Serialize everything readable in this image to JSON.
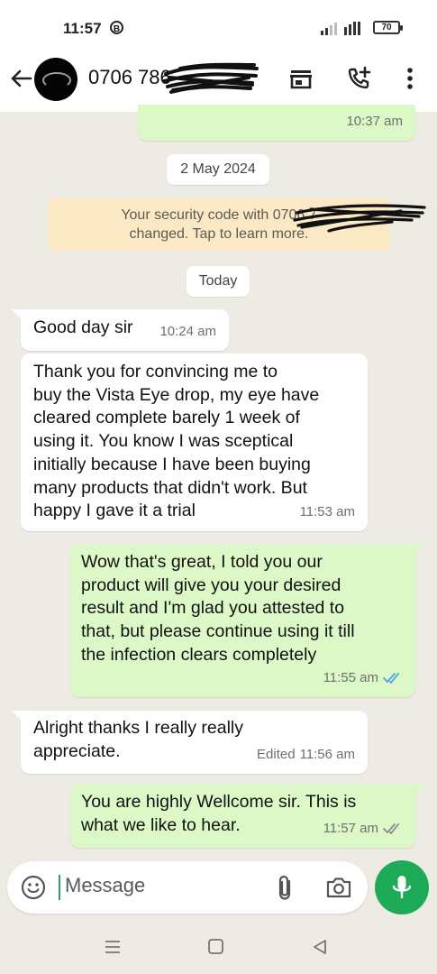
{
  "status_bar": {
    "time": "11:57",
    "notification_badge": "B",
    "battery": "70"
  },
  "header": {
    "contact_name": "0706 786"
  },
  "date_chips": [
    "2 May 2024",
    "Today"
  ],
  "security_notice": {
    "line1": "Your security code with 0706 7",
    "line2": "changed. Tap to learn more."
  },
  "messages": [
    {
      "direction": "out",
      "text": "",
      "time": "10:37 am"
    },
    {
      "direction": "in",
      "text": "Good day sir",
      "time": "10:24 am"
    },
    {
      "direction": "in",
      "lines": [
        "Thank you for convincing me to",
        "buy the Vista Eye drop, my eye have",
        "cleared complete barely 1 week of",
        "using it. You know I was sceptical",
        "initially because I have been buying",
        "many products that didn't work. But",
        "happy I gave it a trial"
      ],
      "time": "11:53 am"
    },
    {
      "direction": "out",
      "lines": [
        "Wow that's great, I told you our",
        "product will give you your desired",
        "result and I'm glad you attested to",
        "that, but please continue using it till",
        "the infection clears completely"
      ],
      "time": "11:55 am",
      "status": "read"
    },
    {
      "direction": "in",
      "lines": [
        "Alright thanks I really really",
        "appreciate."
      ],
      "edited": "Edited",
      "time": "11:56 am"
    },
    {
      "direction": "out",
      "lines": [
        "You are highly Wellcome sir. This is",
        "what we like to hear."
      ],
      "time": "11:57 am",
      "status": "delivered"
    }
  ],
  "composer": {
    "placeholder": "Message"
  },
  "colors": {
    "chat_background": "#eeeae4",
    "outgoing_bubble": "#dcf8c6",
    "incoming_bubble": "#ffffff",
    "security_notice": "#fbe9c5",
    "accent_green": "#1faa58",
    "read_ticks": "#4fa3e6"
  },
  "icons": {
    "header": [
      "back-arrow-icon",
      "store-icon",
      "add-call-icon",
      "more-vert-icon"
    ],
    "composer": [
      "emoji-icon",
      "attach-icon",
      "camera-icon",
      "mic-icon"
    ],
    "navbar": [
      "menu-icon",
      "home-icon",
      "back-triangle-icon"
    ]
  }
}
